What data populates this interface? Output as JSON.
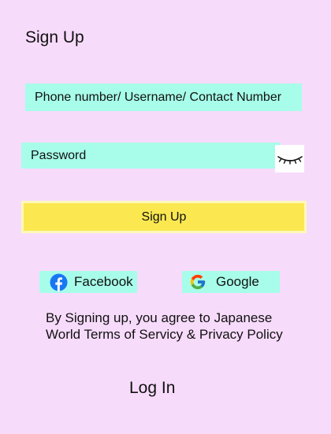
{
  "header": {
    "title": "Sign Up"
  },
  "form": {
    "username_placeholder": "Phone number/ Username/ Contact Number",
    "password_placeholder": "Password",
    "signup_button": "Sign Up"
  },
  "social": {
    "facebook_label": "Facebook",
    "google_label": "Google"
  },
  "terms": {
    "line1": "By Signing up, you agree to Japanese",
    "line2": "World Terms of Servicy & Privacy Policy"
  },
  "footer": {
    "login_label": "Log In"
  },
  "icons": {
    "password_toggle": "eye-closed-icon",
    "facebook": "facebook-icon",
    "google": "google-icon"
  },
  "colors": {
    "background": "#f7dbfb",
    "field": "#a7fde9",
    "primary_button": "#fbe851",
    "facebook": "#1877f2"
  }
}
